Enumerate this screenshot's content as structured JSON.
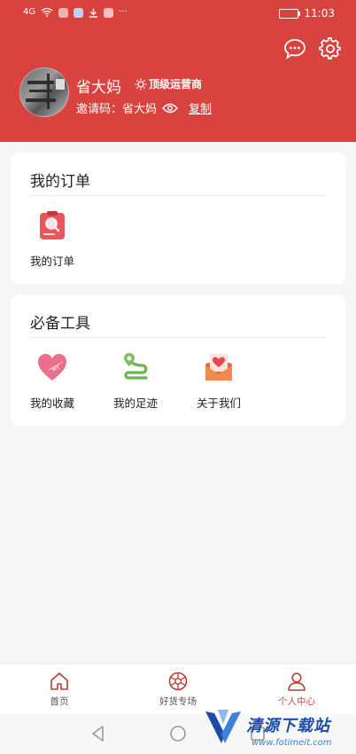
{
  "status": {
    "time": "11:03",
    "signal_text": "4G",
    "dots": "···"
  },
  "header": {
    "username": "省大妈",
    "badge": "顶级运营商",
    "invite_label": "邀请码：",
    "invite_code": "省大妈",
    "copy_label": "复制",
    "icons": [
      "message-icon",
      "gear-icon",
      "eye-icon"
    ]
  },
  "orders": {
    "title": "我的订单",
    "items": [
      {
        "label": "我的订单",
        "icon": "order-search-icon"
      }
    ]
  },
  "tools": {
    "title": "必备工具",
    "items": [
      {
        "label": "我的收藏",
        "icon": "heart-icon"
      },
      {
        "label": "我的足迹",
        "icon": "route-icon"
      },
      {
        "label": "关于我们",
        "icon": "mail-heart-icon"
      }
    ]
  },
  "tabbar": {
    "tabs": [
      {
        "label": "首页",
        "icon": "home-icon",
        "active": false
      },
      {
        "label": "好货专场",
        "icon": "aperture-icon",
        "active": false
      },
      {
        "label": "个人中心",
        "icon": "user-icon",
        "active": true
      }
    ]
  },
  "watermark": {
    "title": "清源下载站",
    "url": "www.fotimeit.com"
  },
  "colors": {
    "brand": "#d9433f",
    "background": "#f6f6f6"
  }
}
